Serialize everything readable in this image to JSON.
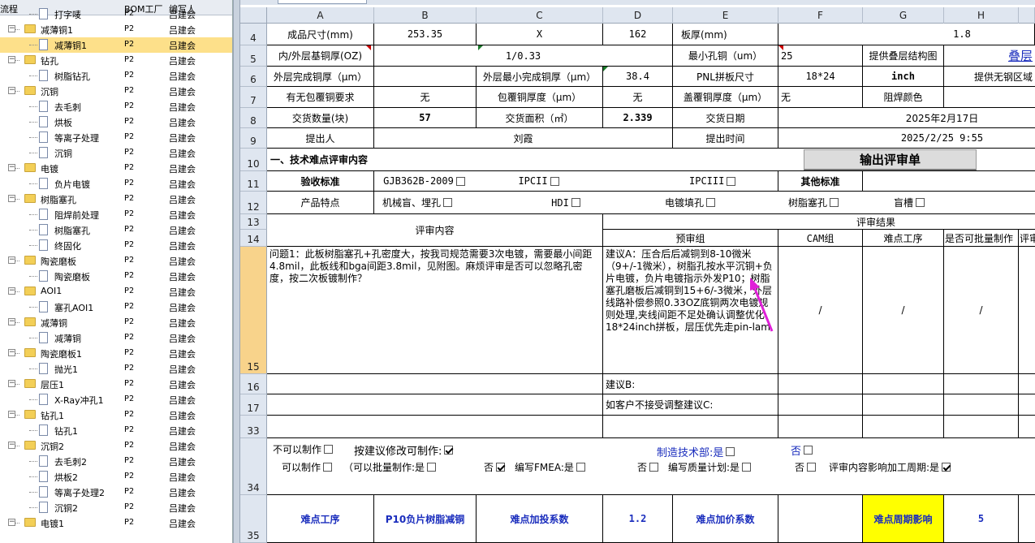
{
  "tree": {
    "columns": [
      "流程",
      "BOM工厂",
      "编写人"
    ],
    "rows": [
      {
        "name": "打字唛",
        "level": 2,
        "bom": "P2",
        "author": "吕建会",
        "toggle": ""
      },
      {
        "name": "减薄铜1",
        "level": 1,
        "bom": "P2",
        "author": "吕建会",
        "toggle": "−"
      },
      {
        "name": "减薄铜1",
        "level": 2,
        "bom": "P2",
        "author": "吕建会",
        "toggle": "",
        "selected": true
      },
      {
        "name": "钻孔",
        "level": 1,
        "bom": "P2",
        "author": "吕建会",
        "toggle": "−"
      },
      {
        "name": "树脂钻孔",
        "level": 2,
        "bom": "P2",
        "author": "吕建会",
        "toggle": ""
      },
      {
        "name": "沉铜",
        "level": 1,
        "bom": "P2",
        "author": "吕建会",
        "toggle": "−"
      },
      {
        "name": "去毛刺",
        "level": 2,
        "bom": "P2",
        "author": "吕建会",
        "toggle": ""
      },
      {
        "name": "烘板",
        "level": 2,
        "bom": "P2",
        "author": "吕建会",
        "toggle": ""
      },
      {
        "name": "等离子处理",
        "level": 2,
        "bom": "P2",
        "author": "吕建会",
        "toggle": ""
      },
      {
        "name": "沉铜",
        "level": 2,
        "bom": "P2",
        "author": "吕建会",
        "toggle": ""
      },
      {
        "name": "电镀",
        "level": 1,
        "bom": "P2",
        "author": "吕建会",
        "toggle": "−"
      },
      {
        "name": "负片电镀",
        "level": 2,
        "bom": "P2",
        "author": "吕建会",
        "toggle": ""
      },
      {
        "name": "树脂塞孔",
        "level": 1,
        "bom": "P2",
        "author": "吕建会",
        "toggle": "−"
      },
      {
        "name": "阻焊前处理",
        "level": 2,
        "bom": "P2",
        "author": "吕建会",
        "toggle": ""
      },
      {
        "name": "树脂塞孔",
        "level": 2,
        "bom": "P2",
        "author": "吕建会",
        "toggle": ""
      },
      {
        "name": "终固化",
        "level": 2,
        "bom": "P2",
        "author": "吕建会",
        "toggle": ""
      },
      {
        "name": "陶瓷磨板",
        "level": 1,
        "bom": "P2",
        "author": "吕建会",
        "toggle": "−"
      },
      {
        "name": "陶瓷磨板",
        "level": 2,
        "bom": "P2",
        "author": "吕建会",
        "toggle": ""
      },
      {
        "name": "AOI1",
        "level": 1,
        "bom": "P2",
        "author": "吕建会",
        "toggle": "−"
      },
      {
        "name": "塞孔AOI1",
        "level": 2,
        "bom": "P2",
        "author": "吕建会",
        "toggle": ""
      },
      {
        "name": "减薄铜",
        "level": 1,
        "bom": "P2",
        "author": "吕建会",
        "toggle": "−"
      },
      {
        "name": "减薄铜",
        "level": 2,
        "bom": "P2",
        "author": "吕建会",
        "toggle": ""
      },
      {
        "name": "陶瓷磨板1",
        "level": 1,
        "bom": "P2",
        "author": "吕建会",
        "toggle": "−"
      },
      {
        "name": "抛光1",
        "level": 2,
        "bom": "P2",
        "author": "吕建会",
        "toggle": ""
      },
      {
        "name": "层压1",
        "level": 1,
        "bom": "P2",
        "author": "吕建会",
        "toggle": "−"
      },
      {
        "name": "X-Ray冲孔1",
        "level": 2,
        "bom": "P2",
        "author": "吕建会",
        "toggle": ""
      },
      {
        "name": "钻孔1",
        "level": 1,
        "bom": "P2",
        "author": "吕建会",
        "toggle": "−"
      },
      {
        "name": "钻孔1",
        "level": 2,
        "bom": "P2",
        "author": "吕建会",
        "toggle": ""
      },
      {
        "name": "沉铜2",
        "level": 1,
        "bom": "P2",
        "author": "吕建会",
        "toggle": "−"
      },
      {
        "name": "去毛刺2",
        "level": 2,
        "bom": "P2",
        "author": "吕建会",
        "toggle": ""
      },
      {
        "name": "烘板2",
        "level": 2,
        "bom": "P2",
        "author": "吕建会",
        "toggle": ""
      },
      {
        "name": "等离子处理2",
        "level": 2,
        "bom": "P2",
        "author": "吕建会",
        "toggle": ""
      },
      {
        "name": "沉铜2",
        "level": 2,
        "bom": "P2",
        "author": "吕建会",
        "toggle": ""
      },
      {
        "name": "电镀1",
        "level": 1,
        "bom": "P2",
        "author": "吕建会",
        "toggle": "−"
      }
    ]
  },
  "sheet": {
    "columns": [
      "A",
      "B",
      "C",
      "D",
      "E",
      "F",
      "G",
      "H"
    ],
    "row_numbers": [
      "4",
      "5",
      "6",
      "7",
      "8",
      "9",
      "10",
      "11",
      "12",
      "13",
      "14",
      "15",
      "16",
      "17",
      "33",
      "34",
      "35"
    ],
    "r4": {
      "a": "成品尺寸(mm)",
      "b": "253.35",
      "c": "X",
      "d": "162",
      "e": "板厚(mm)",
      "h": "1.8"
    },
    "r5": {
      "a": "内/外层基铜厚(OZ)",
      "bc": "1/0.33",
      "e": "最小孔铜（um）",
      "f": "25",
      "g": "提供叠层结构图",
      "h": "叠层"
    },
    "r6": {
      "a": "外层完成铜厚（μm）",
      "c": "外层最小完成铜厚（μm）",
      "d": "38.4",
      "e": "PNL拼板尺寸",
      "f": "18*24",
      "g": "inch",
      "h": "提供无钢区域"
    },
    "r7": {
      "a": "有无包覆铜要求",
      "b": "无",
      "c": "包覆铜厚度（μm）",
      "d": "无",
      "e": "盖覆铜厚度（μm）",
      "f": "无",
      "g": "阻焊颜色"
    },
    "r8": {
      "a": "交货数量(块)",
      "b": "57",
      "c": "交货面积（㎡）",
      "d": "2.339",
      "e": "交货日期",
      "fh": "2025年2月17日"
    },
    "r9": {
      "a": "提出人",
      "bd": "刘霞",
      "e": "提出时间",
      "fh": "2025/2/25 9:55"
    },
    "r10": {
      "title": "一、技术难点评审内容",
      "button": "输出评审单"
    },
    "r11": {
      "a": "验收标准",
      "b": "GJB362B-2009",
      "c": "IPCII",
      "d": "IPCIII",
      "g": "其他标准"
    },
    "r12": {
      "a": "产品特点",
      "b": "机械盲、埋孔",
      "c": "HDI",
      "d": "电镀填孔",
      "f": "树脂塞孔",
      "g": "盲槽"
    },
    "r13": {
      "left": "评审内容",
      "right": "评审结果"
    },
    "r14": {
      "d": "预审组",
      "f": "CAM组",
      "g": "难点工序",
      "h": "是否可批量制作",
      "i": "评审"
    },
    "r15": {
      "question": "问题1：此板树脂塞孔+孔密度大，按我司规范需要3次电镀，需要最小间距4.8mil，此板线和bga间距3.8mil，见附图。麻烦评审是否可以忽略孔密度，按二次板镀制作？",
      "suggestion": "建议A：压合后后减铜到8-10微米（9+/-1微米），树脂孔按水平沉铜+负片电镀，负片电镀指示外发P10；树脂塞孔磨板后减铜到15+6/-3微米，外层线路补偿参照0.33OZ底铜两次电镀规则处理,夹线间距不足处确认调整优化 18*24inch拼板，层压优先走pin-lam",
      "f": "/",
      "g": "/",
      "h": "/"
    },
    "r16": {
      "suggestion": "建议B:"
    },
    "r17": {
      "suggestion": "如客户不接受调整建议C:"
    },
    "r34": {
      "no_make": "不可以制作",
      "modify_make": "按建议修改可制作:",
      "tech_dept": "制造技术部:是",
      "tech_no": "否",
      "can_make": "可以制作",
      "batch": "（可以批量制作:是",
      "no1": "否",
      "fmea": "编写FMEA:是",
      "no2": "否",
      "quality": "编写质量计划:是",
      "no3": "否",
      "cycle": "评审内容影响加工周期:是"
    },
    "r35": {
      "a": "难点工序",
      "b": "P10负片树脂减铜",
      "c": "难点加投系数",
      "d": "1.2",
      "e": "难点加价系数",
      "g": "难点周期影响",
      "h": "5"
    }
  },
  "colors": {
    "header_bg": "#dfe6f0",
    "active_row": "#f8d38b",
    "selected_tree_row": "#fde08a",
    "highlight": "#ffff00",
    "arrow": "#e020d8",
    "blue_text": "#1a2dbd"
  }
}
